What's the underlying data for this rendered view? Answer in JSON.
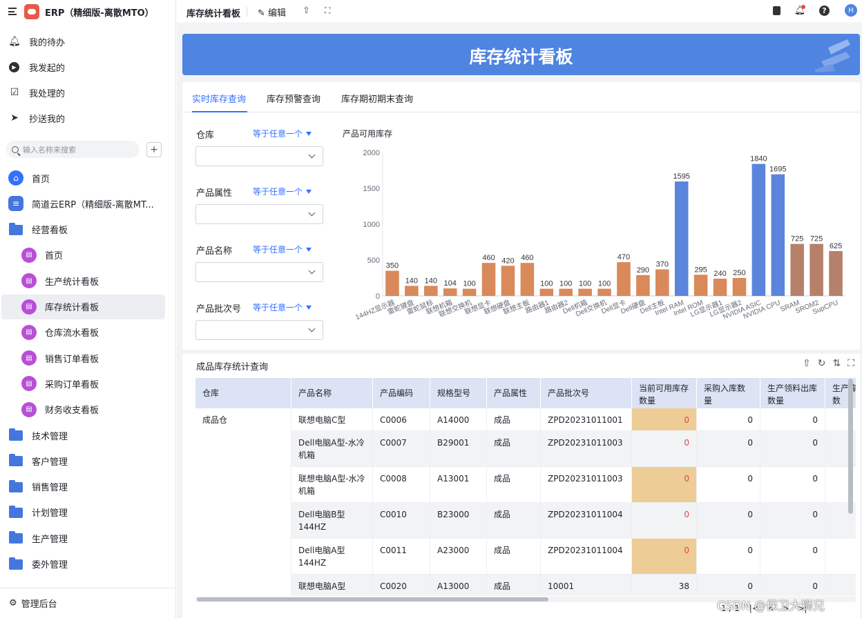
{
  "app": {
    "title": "ERP（精细版-离散MTO）"
  },
  "sidebar": {
    "quick": [
      {
        "label": "我的待办",
        "icon": "bell-icon"
      },
      {
        "label": "我发起的",
        "icon": "play-circle-icon"
      },
      {
        "label": "我处理的",
        "icon": "calendar-check-icon"
      },
      {
        "label": "抄送我的",
        "icon": "send-icon"
      }
    ],
    "search_placeholder": "输入名称来搜索",
    "tree": [
      {
        "label": "首页",
        "icon": "home-icon",
        "level": 0
      },
      {
        "label": "简道云ERP（精细版-离散MT...",
        "icon": "document-icon",
        "level": 0
      },
      {
        "label": "经营看板",
        "icon": "folder-open-icon",
        "level": 0
      },
      {
        "label": "首页",
        "icon": "dashboard-icon",
        "level": 1
      },
      {
        "label": "生产统计看板",
        "icon": "dashboard-icon",
        "level": 1
      },
      {
        "label": "库存统计看板",
        "icon": "dashboard-icon",
        "level": 1,
        "active": true
      },
      {
        "label": "仓库流水看板",
        "icon": "dashboard-icon",
        "level": 1
      },
      {
        "label": "销售订单看板",
        "icon": "dashboard-icon",
        "level": 1
      },
      {
        "label": "采购订单看板",
        "icon": "dashboard-icon",
        "level": 1
      },
      {
        "label": "财务收支看板",
        "icon": "dashboard-icon",
        "level": 1
      },
      {
        "label": "技术管理",
        "icon": "folder-icon",
        "level": 0
      },
      {
        "label": "客户管理",
        "icon": "folder-icon",
        "level": 0
      },
      {
        "label": "销售管理",
        "icon": "folder-icon",
        "level": 0
      },
      {
        "label": "计划管理",
        "icon": "folder-icon",
        "level": 0
      },
      {
        "label": "生产管理",
        "icon": "folder-icon",
        "level": 0
      },
      {
        "label": "委外管理",
        "icon": "folder-icon",
        "level": 0
      }
    ],
    "footer": "管理后台"
  },
  "topbar": {
    "title": "库存统计看板",
    "edit_label": "编辑",
    "avatar_letter": "H"
  },
  "banner": {
    "title": "库存统计看板"
  },
  "tabs": [
    "实时库存查询",
    "库存预警查询",
    "库存期初期末查询"
  ],
  "filters": [
    {
      "label": "仓库",
      "operator": "等于任意一个"
    },
    {
      "label": "产品属性",
      "operator": "等于任意一个"
    },
    {
      "label": "产品名称",
      "operator": "等于任意一个"
    },
    {
      "label": "产品批次号",
      "operator": "等于任意一个"
    }
  ],
  "chart_data": {
    "type": "bar",
    "title": "产品可用库存",
    "ylim": [
      0,
      2000
    ],
    "yticks": [
      0,
      500,
      1000,
      1500,
      2000
    ],
    "grid": false,
    "categories": [
      "144HZ显示器",
      "雷蛇键盘",
      "雷蛇鼠标",
      "联想机箱",
      "联想交换机",
      "联想显卡",
      "联想硬盘",
      "联想主板",
      "路由器1",
      "路由器2",
      "Dell机箱",
      "Dell交换机",
      "Dell显卡",
      "Dell硬盘",
      "Dell主板",
      "Intel RAM",
      "Intel ROM",
      "LG显示器1",
      "LG显示器2",
      "NVIDIA ASIC",
      "NVIDIA CPU",
      "SRAM",
      "SROM2",
      "SupCPU"
    ],
    "values": [
      350,
      140,
      140,
      104,
      100,
      460,
      420,
      460,
      100,
      100,
      100,
      100,
      470,
      290,
      370,
      1595,
      295,
      240,
      250,
      1840,
      1695,
      725,
      725,
      625
    ],
    "colors": {
      "default": "#d9895a",
      "highlight": "#5b84dc",
      "muted": "#b5816a"
    }
  },
  "table": {
    "title": "成品库存统计查询",
    "columns": [
      "仓库",
      "产品名称",
      "产品编码",
      "规格型号",
      "产品属性",
      "产品批次号",
      "当前可用库存数量",
      "采购入库数量",
      "生产领料出库数量",
      "生产库数"
    ],
    "warehouse": "成品仓",
    "rows": [
      [
        "联想电脑C型",
        "C0006",
        "A14000",
        "成品",
        "ZPD20231011001",
        "0",
        "0",
        "0"
      ],
      [
        "Dell电脑A型-水冷机箱",
        "C0007",
        "B29001",
        "成品",
        "ZPD20231011003",
        "0",
        "0",
        "0"
      ],
      [
        "联想电脑A型-水冷机箱",
        "C0008",
        "A13001",
        "成品",
        "ZPD20231011003",
        "0",
        "0",
        "0"
      ],
      [
        "Dell电脑B型144HZ",
        "C0010",
        "B23000",
        "成品",
        "ZPD20231011004",
        "0",
        "0",
        "0"
      ],
      [
        "Dell电脑A型144HZ",
        "C0011",
        "A23000",
        "成品",
        "ZPD20231011004",
        "0",
        "0",
        "0"
      ],
      [
        "联想电脑A型",
        "C0020",
        "A13000",
        "成品",
        "10001",
        "38",
        "0",
        "0"
      ]
    ],
    "pager": "1 / 1"
  },
  "watermark": "CSDN @保卫大狮兄"
}
